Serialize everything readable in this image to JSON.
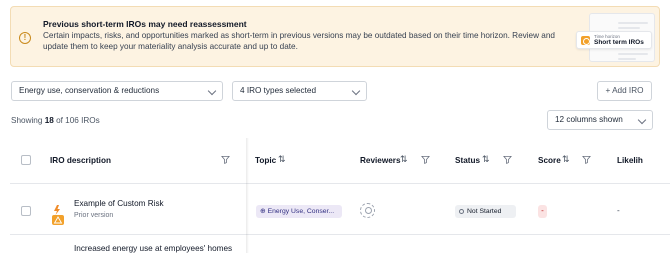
{
  "banner": {
    "title": "Previous short-term IROs may need reassessment",
    "body": "Certain impacts, risks, and opportunities marked as short-term in previous versions may be outdated based on their time horizon. Review and update them to keep your materiality analysis accurate and up to date.",
    "badge_small": "Time horizon",
    "badge_big": "Short term IROs",
    "accent": "#f2a12b"
  },
  "filters": {
    "topic_value": "Energy use, conservation & reductions",
    "types_value": "4 IRO types selected",
    "add_label": "+ Add IRO",
    "columns_value": "12 columns shown"
  },
  "summary": {
    "prefix": "Showing ",
    "count": "18",
    "suffix": " of 106 IROs"
  },
  "table": {
    "headers": {
      "description": "IRO description",
      "topic": "Topic",
      "reviewers": "Reviewers",
      "status": "Status",
      "score": "Score",
      "likelihood": "Likelih"
    },
    "rows": [
      {
        "title": "Example of Custom Risk",
        "subtitle": "Prior version",
        "topic": "Energy Use, Conser...",
        "status": "Not Started",
        "score": "-",
        "likelihood": "-"
      }
    ],
    "next_row_title": "Increased energy use at employees' homes"
  }
}
